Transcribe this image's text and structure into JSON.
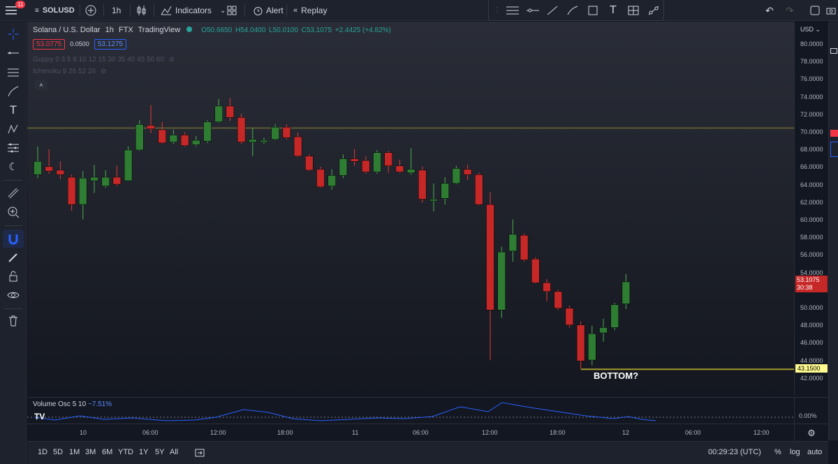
{
  "toolbar": {
    "notification_count": "11",
    "symbol": "SOLUSD",
    "interval": "1h",
    "indicators_label": "Indicators",
    "alert_label": "Alert",
    "replay_label": "Replay"
  },
  "legend": {
    "title": "Solana / U.S. Dollar",
    "interval": "1h",
    "exchange": "FTX",
    "source": "TradingView",
    "open": "O50.6650",
    "high": "H54.0400",
    "low": "L50.0100",
    "close": "C53.1075",
    "change": "+2.4425 (+4.82%)",
    "sell_price": "53.0775",
    "spread": "0.0500",
    "buy_price": "53.1275",
    "guppy": "Guppy 0 3 5 8 10 12 15 30 35 40 45 50 60",
    "ichimoku": "Ichimoku 9 26 52 26"
  },
  "colors": {
    "up": "#26a69a",
    "up_body": "#2e7d32",
    "down": "#c62828",
    "level_line": "#5c5a35",
    "bottom_line": "#a39a2e",
    "osc_line": "#2962ff"
  },
  "price_axis": {
    "currency": "USD",
    "labels": [
      "80.0000",
      "78.0000",
      "76.0000",
      "74.0000",
      "72.0000",
      "70.0000",
      "68.0000",
      "66.0000",
      "64.0000",
      "62.0000",
      "60.0000",
      "58.0000",
      "56.0000",
      "54.0000",
      "52.0000",
      "50.0000",
      "48.0000",
      "46.0000",
      "44.0000",
      "42.0000"
    ],
    "last_price": "53.1075",
    "countdown": "30:38",
    "bottom_price": "43.1500"
  },
  "annotation": {
    "bottom_text": "BOTTOM?"
  },
  "oscillator": {
    "name": "Volume Osc",
    "params": "5 10",
    "value": "−7.51%",
    "axis_label": "0.00%"
  },
  "time_axis": [
    "10",
    "06:00",
    "12:00",
    "18:00",
    "11",
    "06:00",
    "12:00",
    "18:00",
    "12",
    "06:00",
    "12:00"
  ],
  "bottombar": {
    "ranges": [
      "1D",
      "5D",
      "1M",
      "3M",
      "6M",
      "YTD",
      "1Y",
      "5Y",
      "All"
    ],
    "clock": "00:29:23 (UTC)",
    "percent_label": "%",
    "log_label": "log",
    "auto_label": "auto"
  },
  "chart_data": {
    "type": "candlestick",
    "y_range": [
      41,
      82
    ],
    "horizontal_levels": [
      70.6,
      43.15
    ],
    "candles": [
      [
        65.3,
        66.8,
        64.9,
        68.5
      ],
      [
        66.2,
        65.7,
        65.4,
        68.2
      ],
      [
        65.8,
        65.3,
        64.8,
        66.8
      ],
      [
        65.0,
        61.9,
        61.2,
        65.3
      ],
      [
        61.9,
        64.9,
        60.2,
        65.7
      ],
      [
        64.6,
        65.0,
        63.2,
        66.4
      ],
      [
        64.0,
        65.0,
        63.8,
        65.8
      ],
      [
        65.0,
        64.2,
        64.0,
        66.3
      ],
      [
        64.6,
        68.1,
        64.6,
        68.5
      ],
      [
        68.1,
        71.0,
        68.0,
        71.5
      ],
      [
        70.9,
        70.5,
        70.0,
        73.2
      ],
      [
        70.4,
        68.9,
        68.8,
        71.3
      ],
      [
        69.0,
        69.8,
        68.8,
        70.4
      ],
      [
        69.8,
        68.6,
        68.5,
        70.1
      ],
      [
        68.7,
        69.2,
        68.5,
        69.7
      ],
      [
        69.1,
        71.3,
        68.9,
        71.5
      ],
      [
        71.3,
        73.1,
        71.2,
        73.9
      ],
      [
        73.1,
        71.8,
        71.4,
        74.0
      ],
      [
        71.8,
        69.0,
        68.8,
        72.2
      ],
      [
        69.0,
        69.3,
        67.4,
        70.6
      ],
      [
        69.0,
        69.2,
        68.8,
        69.5
      ],
      [
        69.3,
        70.7,
        69.2,
        71.0
      ],
      [
        70.7,
        69.5,
        69.3,
        71.0
      ],
      [
        69.6,
        67.4,
        67.3,
        70.1
      ],
      [
        67.4,
        65.8,
        65.7,
        67.6
      ],
      [
        65.9,
        63.9,
        63.8,
        66.2
      ],
      [
        64.0,
        65.2,
        63.6,
        65.9
      ],
      [
        65.2,
        67.1,
        64.9,
        67.6
      ],
      [
        67.1,
        66.8,
        66.3,
        68.2
      ],
      [
        66.9,
        65.6,
        65.4,
        67.4
      ],
      [
        65.6,
        67.8,
        65.4,
        68.1
      ],
      [
        67.8,
        66.3,
        65.5,
        68.0
      ],
      [
        66.3,
        65.6,
        65.5,
        67.0
      ],
      [
        65.5,
        65.9,
        65.3,
        68.3
      ],
      [
        65.8,
        62.5,
        62.1,
        66.2
      ],
      [
        62.3,
        62.5,
        61.1,
        64.3
      ],
      [
        62.6,
        64.3,
        61.9,
        65.0
      ],
      [
        64.3,
        66.0,
        64.2,
        66.3
      ],
      [
        65.9,
        65.3,
        64.7,
        66.4
      ],
      [
        65.3,
        61.9,
        61.8,
        65.5
      ],
      [
        61.9,
        49.9,
        44.2,
        63.3
      ],
      [
        49.9,
        56.5,
        49.0,
        57.1
      ],
      [
        56.6,
        58.5,
        55.4,
        60.2
      ],
      [
        58.4,
        55.6,
        55.4,
        58.6
      ],
      [
        55.7,
        53.0,
        52.9,
        55.9
      ],
      [
        53.0,
        52.0,
        50.9,
        53.4
      ],
      [
        52.0,
        50.1,
        49.9,
        52.2
      ],
      [
        50.1,
        48.2,
        47.9,
        50.4
      ],
      [
        48.2,
        44.1,
        43.2,
        48.6
      ],
      [
        44.2,
        47.2,
        43.6,
        48.1
      ],
      [
        47.3,
        47.9,
        46.3,
        48.9
      ],
      [
        47.9,
        50.5,
        47.6,
        50.7
      ],
      [
        50.6,
        53.1,
        50.0,
        54.0
      ]
    ]
  }
}
